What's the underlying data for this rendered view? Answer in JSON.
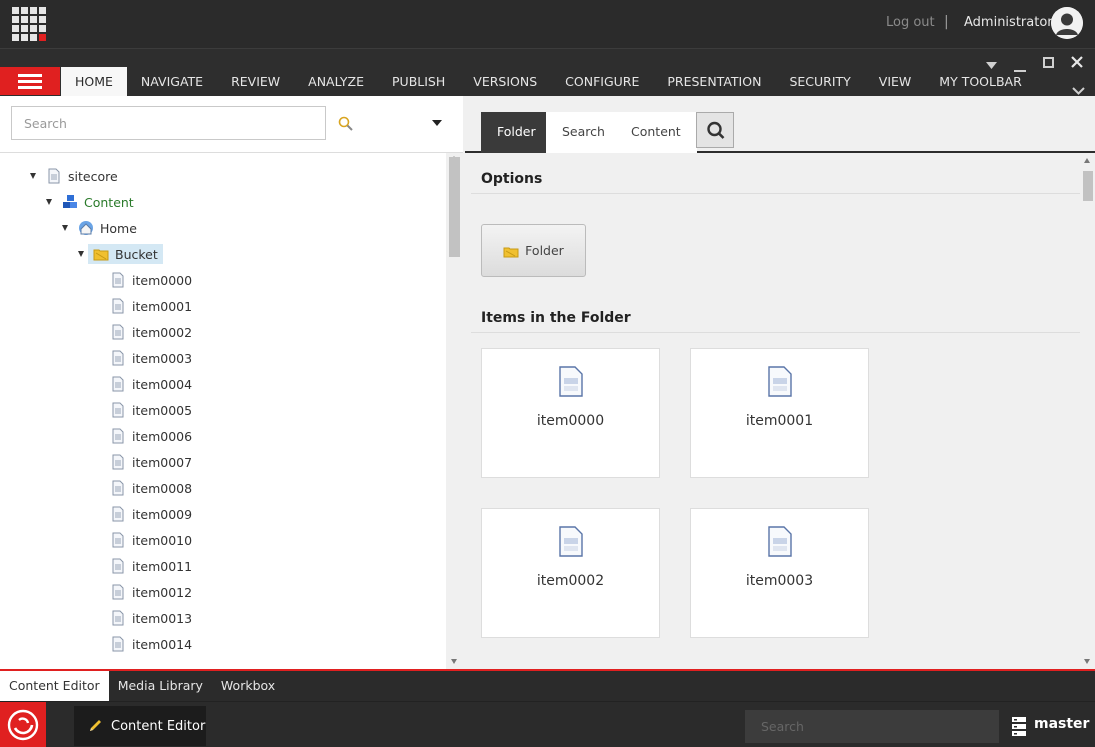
{
  "header": {
    "logout_label": "Log out",
    "separator": "|",
    "username": "Administrator"
  },
  "ribbon": {
    "tabs": [
      "HOME",
      "NAVIGATE",
      "REVIEW",
      "ANALYZE",
      "PUBLISH",
      "VERSIONS",
      "CONFIGURE",
      "PRESENTATION",
      "SECURITY",
      "VIEW",
      "MY TOOLBAR"
    ],
    "active_tab": "HOME"
  },
  "tree_search": {
    "placeholder": "Search"
  },
  "tree": {
    "root": "sitecore",
    "content": "Content",
    "home": "Home",
    "bucket": "Bucket",
    "items": [
      "item0000",
      "item0001",
      "item0002",
      "item0003",
      "item0004",
      "item0005",
      "item0006",
      "item0007",
      "item0008",
      "item0009",
      "item0010",
      "item0011",
      "item0012",
      "item0013",
      "item0014"
    ]
  },
  "editor_tabs": {
    "folder": "Folder",
    "search": "Search",
    "content": "Content"
  },
  "folder_view": {
    "options_title": "Options",
    "folder_button": "Folder",
    "items_title": "Items in the Folder",
    "cards": [
      "item0000",
      "item0001",
      "item0002",
      "item0003"
    ]
  },
  "bottom_tabs": [
    "Content Editor",
    "Media Library",
    "Workbox"
  ],
  "taskbar": {
    "app_label": "Content Editor",
    "search_placeholder": "Search",
    "database": "master"
  },
  "colors": {
    "accent_red": "#e02020",
    "dark_bar": "#2b2b2b",
    "content_green": "#2a7a2a",
    "selection_blue": "#d4e8f4"
  }
}
